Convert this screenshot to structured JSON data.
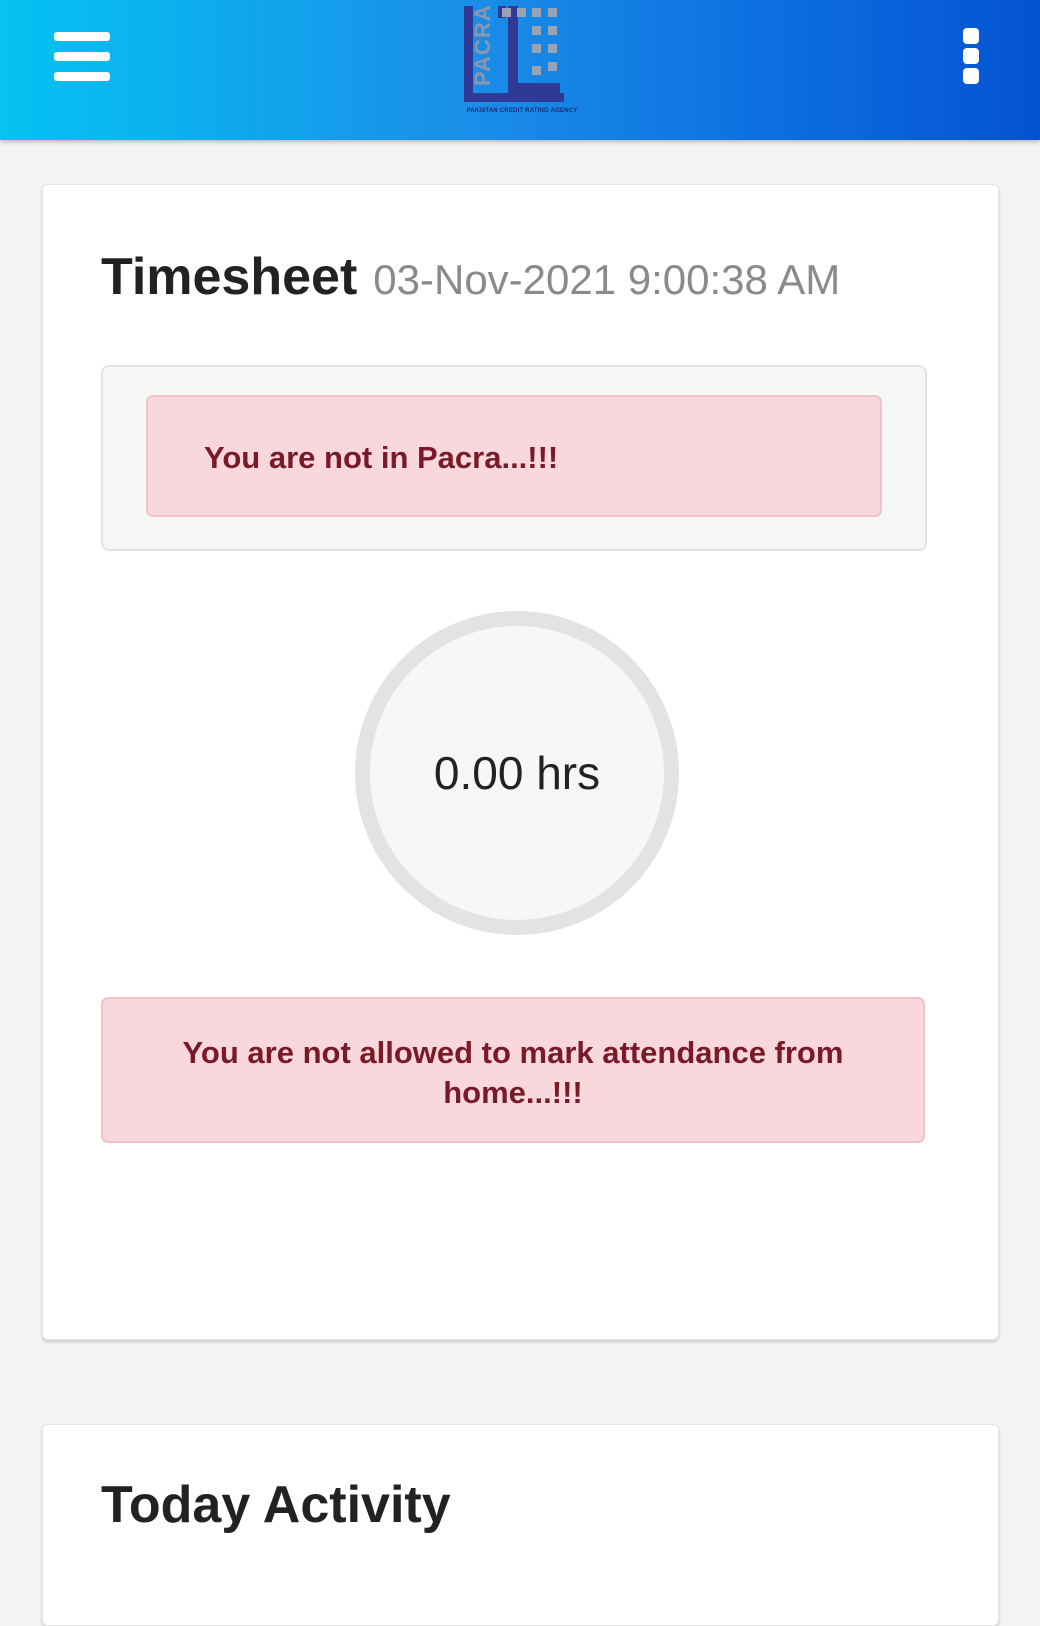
{
  "header": {
    "logo_text": "PACRA",
    "logo_tagline": "PAKISTAN CREDIT RATING AGENCY",
    "menu_icon": "hamburger-menu-icon",
    "more_icon": "more-vertical-icon",
    "gradient_start": "#05c3f3",
    "gradient_end": "#0552d1"
  },
  "timesheet": {
    "title": "Timesheet",
    "datetime": "03-Nov-2021 9:00:38 AM",
    "location_alert": "You are not in Pacra...!!!",
    "hours": "0.00 hrs",
    "attendance_alert": "You are not allowed to mark attendance from home...!!!"
  },
  "activity": {
    "title": "Today Activity"
  },
  "colors": {
    "alert_bg": "#f8d7dd",
    "alert_text": "#7a1a28"
  }
}
